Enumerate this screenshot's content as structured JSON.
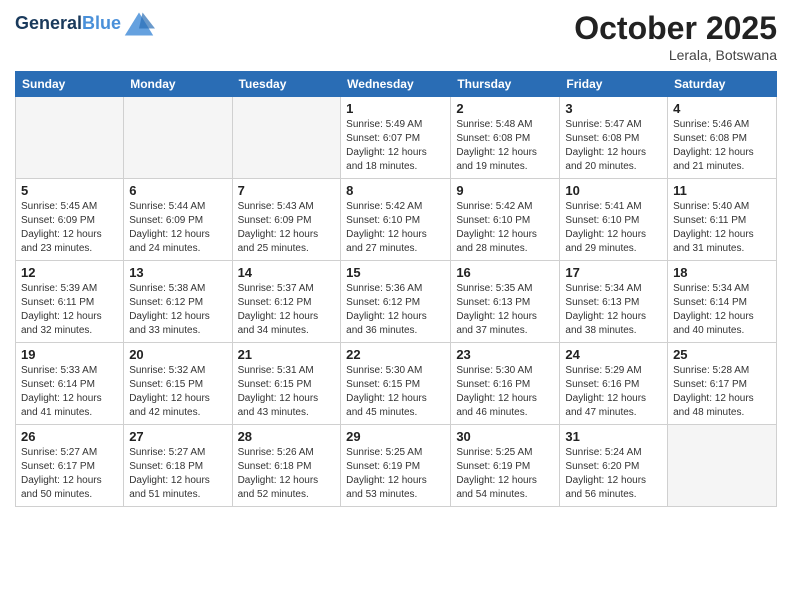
{
  "header": {
    "logo_line1": "General",
    "logo_line2": "Blue",
    "month": "October 2025",
    "location": "Lerala, Botswana"
  },
  "weekdays": [
    "Sunday",
    "Monday",
    "Tuesday",
    "Wednesday",
    "Thursday",
    "Friday",
    "Saturday"
  ],
  "weeks": [
    [
      {
        "day": "",
        "info": ""
      },
      {
        "day": "",
        "info": ""
      },
      {
        "day": "",
        "info": ""
      },
      {
        "day": "1",
        "info": "Sunrise: 5:49 AM\nSunset: 6:07 PM\nDaylight: 12 hours\nand 18 minutes."
      },
      {
        "day": "2",
        "info": "Sunrise: 5:48 AM\nSunset: 6:08 PM\nDaylight: 12 hours\nand 19 minutes."
      },
      {
        "day": "3",
        "info": "Sunrise: 5:47 AM\nSunset: 6:08 PM\nDaylight: 12 hours\nand 20 minutes."
      },
      {
        "day": "4",
        "info": "Sunrise: 5:46 AM\nSunset: 6:08 PM\nDaylight: 12 hours\nand 21 minutes."
      }
    ],
    [
      {
        "day": "5",
        "info": "Sunrise: 5:45 AM\nSunset: 6:09 PM\nDaylight: 12 hours\nand 23 minutes."
      },
      {
        "day": "6",
        "info": "Sunrise: 5:44 AM\nSunset: 6:09 PM\nDaylight: 12 hours\nand 24 minutes."
      },
      {
        "day": "7",
        "info": "Sunrise: 5:43 AM\nSunset: 6:09 PM\nDaylight: 12 hours\nand 25 minutes."
      },
      {
        "day": "8",
        "info": "Sunrise: 5:42 AM\nSunset: 6:10 PM\nDaylight: 12 hours\nand 27 minutes."
      },
      {
        "day": "9",
        "info": "Sunrise: 5:42 AM\nSunset: 6:10 PM\nDaylight: 12 hours\nand 28 minutes."
      },
      {
        "day": "10",
        "info": "Sunrise: 5:41 AM\nSunset: 6:10 PM\nDaylight: 12 hours\nand 29 minutes."
      },
      {
        "day": "11",
        "info": "Sunrise: 5:40 AM\nSunset: 6:11 PM\nDaylight: 12 hours\nand 31 minutes."
      }
    ],
    [
      {
        "day": "12",
        "info": "Sunrise: 5:39 AM\nSunset: 6:11 PM\nDaylight: 12 hours\nand 32 minutes."
      },
      {
        "day": "13",
        "info": "Sunrise: 5:38 AM\nSunset: 6:12 PM\nDaylight: 12 hours\nand 33 minutes."
      },
      {
        "day": "14",
        "info": "Sunrise: 5:37 AM\nSunset: 6:12 PM\nDaylight: 12 hours\nand 34 minutes."
      },
      {
        "day": "15",
        "info": "Sunrise: 5:36 AM\nSunset: 6:12 PM\nDaylight: 12 hours\nand 36 minutes."
      },
      {
        "day": "16",
        "info": "Sunrise: 5:35 AM\nSunset: 6:13 PM\nDaylight: 12 hours\nand 37 minutes."
      },
      {
        "day": "17",
        "info": "Sunrise: 5:34 AM\nSunset: 6:13 PM\nDaylight: 12 hours\nand 38 minutes."
      },
      {
        "day": "18",
        "info": "Sunrise: 5:34 AM\nSunset: 6:14 PM\nDaylight: 12 hours\nand 40 minutes."
      }
    ],
    [
      {
        "day": "19",
        "info": "Sunrise: 5:33 AM\nSunset: 6:14 PM\nDaylight: 12 hours\nand 41 minutes."
      },
      {
        "day": "20",
        "info": "Sunrise: 5:32 AM\nSunset: 6:15 PM\nDaylight: 12 hours\nand 42 minutes."
      },
      {
        "day": "21",
        "info": "Sunrise: 5:31 AM\nSunset: 6:15 PM\nDaylight: 12 hours\nand 43 minutes."
      },
      {
        "day": "22",
        "info": "Sunrise: 5:30 AM\nSunset: 6:15 PM\nDaylight: 12 hours\nand 45 minutes."
      },
      {
        "day": "23",
        "info": "Sunrise: 5:30 AM\nSunset: 6:16 PM\nDaylight: 12 hours\nand 46 minutes."
      },
      {
        "day": "24",
        "info": "Sunrise: 5:29 AM\nSunset: 6:16 PM\nDaylight: 12 hours\nand 47 minutes."
      },
      {
        "day": "25",
        "info": "Sunrise: 5:28 AM\nSunset: 6:17 PM\nDaylight: 12 hours\nand 48 minutes."
      }
    ],
    [
      {
        "day": "26",
        "info": "Sunrise: 5:27 AM\nSunset: 6:17 PM\nDaylight: 12 hours\nand 50 minutes."
      },
      {
        "day": "27",
        "info": "Sunrise: 5:27 AM\nSunset: 6:18 PM\nDaylight: 12 hours\nand 51 minutes."
      },
      {
        "day": "28",
        "info": "Sunrise: 5:26 AM\nSunset: 6:18 PM\nDaylight: 12 hours\nand 52 minutes."
      },
      {
        "day": "29",
        "info": "Sunrise: 5:25 AM\nSunset: 6:19 PM\nDaylight: 12 hours\nand 53 minutes."
      },
      {
        "day": "30",
        "info": "Sunrise: 5:25 AM\nSunset: 6:19 PM\nDaylight: 12 hours\nand 54 minutes."
      },
      {
        "day": "31",
        "info": "Sunrise: 5:24 AM\nSunset: 6:20 PM\nDaylight: 12 hours\nand 56 minutes."
      },
      {
        "day": "",
        "info": ""
      }
    ]
  ]
}
